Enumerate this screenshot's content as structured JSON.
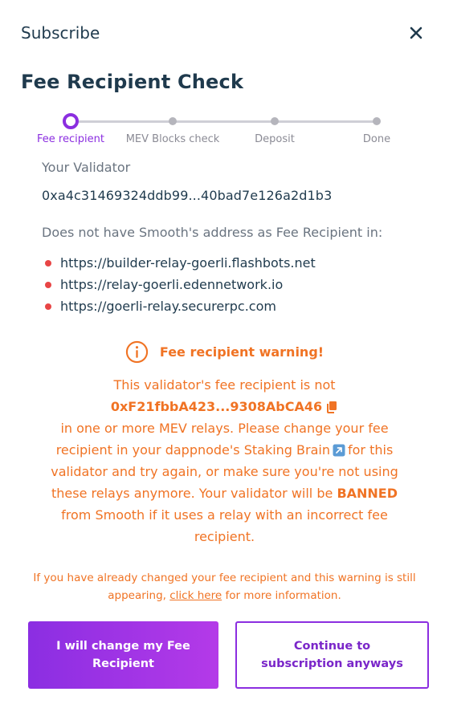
{
  "header": {
    "title": "Subscribe",
    "close_icon": "close-icon"
  },
  "page_title": "Fee Recipient Check",
  "stepper": {
    "active_index": 0,
    "steps": [
      {
        "label": "Fee recipient"
      },
      {
        "label": "MEV Blocks check"
      },
      {
        "label": "Deposit"
      },
      {
        "label": "Done"
      }
    ]
  },
  "validator": {
    "label": "Your Validator",
    "address": "0xa4c31469324ddb99...40bad7e126a2d1b3"
  },
  "missing": {
    "text": "Does not have Smooth's address as Fee Recipient in:",
    "relays": [
      "https://builder-relay-goerli.flashbots.net",
      "https://relay-goerli.edennetwork.io",
      "https://goerli-relay.securerpc.com"
    ]
  },
  "warning": {
    "icon": "info-circle-icon",
    "title": "Fee recipient warning!",
    "line1": "This validator's fee recipient is not",
    "fee_address": "0xF21fbbA423...9308AbCA46",
    "part2": "in one or more MEV relays. Please change your fee recipient in your dappnode's Staking Brain",
    "part3": "for this validator and try again, or make sure you're not using these relays anymore. Your validator will be",
    "banned_word": "BANNED",
    "part4": "from Smooth if it uses a relay with an incorrect fee recipient."
  },
  "note": {
    "before": "If you have already changed your fee recipient and this warning is still appearing,",
    "link": "click here",
    "after": "for more information."
  },
  "buttons": {
    "primary_label": "I will change my Fee Recipient",
    "secondary_label": "Continue to subscription anyways"
  },
  "colors": {
    "accent": "#8b2ee0",
    "warning": "#f07324",
    "bullet": "#e84545",
    "text": "#1f3a4d"
  }
}
